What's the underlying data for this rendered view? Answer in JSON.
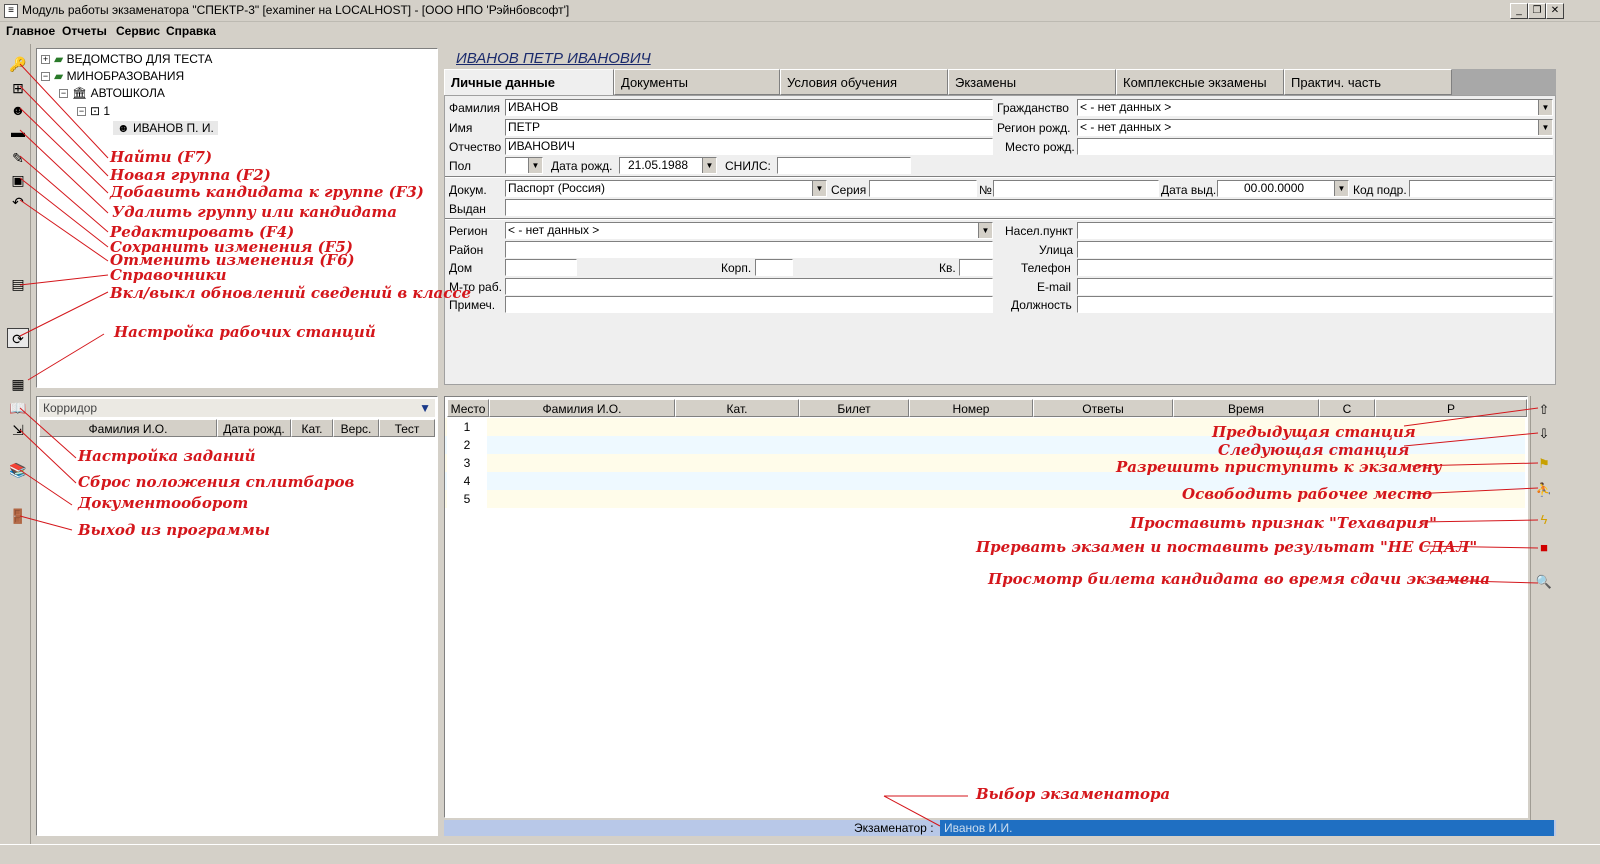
{
  "window": {
    "title": "Модуль работы экзаменатора \"СПЕКТР-3\" [examiner на LOCALHOST] - [ООО НПО 'Рэйнбовсофт']",
    "icon": "app-icon",
    "min": "_",
    "max": "❐",
    "close": "✕"
  },
  "menu": {
    "items": [
      "Главное",
      "Отчеты",
      "Сервис",
      "Справка"
    ]
  },
  "tree": {
    "items": [
      "ВЕДОМСТВО ДЛЯ ТЕСТА",
      "МИНОБРАЗОВАНИЯ",
      "АВТОШКОЛА",
      "1",
      "ИВАНОВ П. И."
    ],
    "expanders": [
      "+",
      "−",
      "−",
      "−"
    ]
  },
  "annotations": {
    "left": [
      "Найти (F7)",
      "Новая группа (F2)",
      "Добавить кандидата к группе (F3)",
      "Удалить группу или кандидата",
      "Редактировать (F4)",
      "Сохранить изменения (F5)",
      "Отменить изменения (F6)",
      "Справочники",
      "Вкл/выкл обновлений сведений в классе",
      "Настройка рабочих станций",
      "Настройка заданий",
      "Сброс положения сплитбаров",
      "Документооборот",
      "Выход из программы"
    ],
    "right": [
      "Предыдущая станция",
      "Следующая станция",
      "Разрешить приступить к экзамену",
      "Освободить рабочее место",
      "Проставить признак \"Техавария\"",
      "Прервать экзамен и поставить результат \"НЕ СДАЛ\"",
      "Просмотр билета кандидата во время сдачи экзамена",
      "Выбор экзаменатора"
    ]
  },
  "corridor": {
    "title": "Корридор",
    "columns": [
      "Фамилия И.О.",
      "Дата рожд.",
      "Кат.",
      "Верс.",
      "Тест"
    ]
  },
  "person": {
    "full_name": "ИВАНОВ ПЕТР ИВАНОВИЧ"
  },
  "tabs": [
    "Личные данные",
    "Документы",
    "Условия обучения",
    "Экзамены",
    "Комплексные экзамены",
    "Практич. часть"
  ],
  "form": {
    "labels": {
      "surname": "Фамилия",
      "name": "Имя",
      "patronymic": "Отчество",
      "sex": "Пол",
      "birth_date": "Дата рожд.",
      "snils": "СНИЛС:",
      "citizenship": "Гражданство",
      "birth_region": "Регион рожд.",
      "birth_place": "Место рожд.",
      "doc": "Докум.",
      "series": "Серия",
      "number": "№",
      "issue_date": "Дата выд.",
      "dept_code": "Код подр.",
      "issued_by": "Выдан",
      "region": "Регион",
      "district": "Район",
      "house": "Дом",
      "building": "Корп.",
      "flat": "Кв.",
      "work_place": "М-то раб.",
      "note": "Примеч.",
      "locality": "Насел.пункт",
      "street": "Улица",
      "phone": "Телефон",
      "email": "E-mail",
      "position": "Должность"
    },
    "values": {
      "surname": "ИВАНОВ",
      "name": "ПЕТР",
      "patronymic": "ИВАНОВИЧ",
      "sex": "",
      "birth_date": "21.05.1988",
      "snils": "",
      "citizenship": "< - нет данных >",
      "birth_region": "< - нет данных >",
      "birth_place": "",
      "doc": "Паспорт (Россия)",
      "issue_date": "00.00.0000",
      "region": "< - нет данных >"
    }
  },
  "grid": {
    "columns": [
      "Место",
      "Фамилия И.О.",
      "Кат.",
      "Билет",
      "Номер",
      "Ответы",
      "Время",
      "С",
      "Р"
    ],
    "rows": [
      "1",
      "2",
      "3",
      "4",
      "5"
    ]
  },
  "status": {
    "examiner_label": "Экзаменатор :",
    "examiner_value": "Иванов И.И."
  },
  "colors": {
    "annotation": "#d4161b",
    "selection": "#1f6fc2",
    "row_alt": "#eef9ff",
    "row_main": "#fffcea"
  }
}
